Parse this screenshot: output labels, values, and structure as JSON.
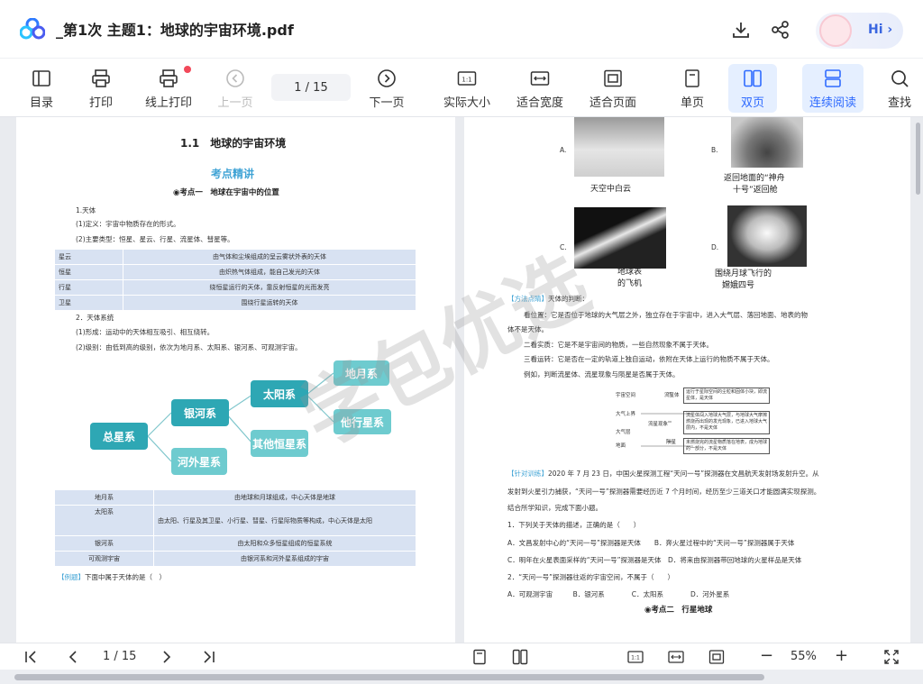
{
  "app": {
    "doc_title": "_第1次 主题1：地球的宇宙环境.pdf",
    "hi_label": "Hi",
    "hi_chevron": "›"
  },
  "icons": {
    "logo": "cloud-logo-icon",
    "download": "download-icon",
    "share": "share-icon"
  },
  "toolbar": {
    "toc": "目录",
    "print": "打印",
    "online_print": "线上打印",
    "prev": "上一页",
    "page_display": "1  / 15",
    "next": "下一页",
    "actual_size": "实际大小",
    "fit_width": "适合宽度",
    "fit_page": "适合页面",
    "single": "单页",
    "double": "双页",
    "continuous": "连续阅读",
    "search": "查找",
    "actual_size_glyph": "1:1"
  },
  "left_page": {
    "title": "1.1　地球的宇宙环境",
    "section": "考点精讲",
    "topic1": "◉考点一　地球在宇宙中的位置",
    "lines": [
      "1.天体",
      "(1)定义：宇宙中物质存在的形式。",
      "(2)主要类型：恒星、星云、行星、流星体、彗星等。"
    ],
    "table1": [
      [
        "星云",
        "由气体和尘埃组成的呈云雾状外表的天体"
      ],
      [
        "恒星",
        "由炽热气体组成，能自己发光的天体"
      ],
      [
        "行星",
        "绕恒星运行的天体，靠反射恒星的光而发亮"
      ],
      [
        "卫星",
        "围绕行星运转的天体"
      ]
    ],
    "lines2": [
      "2．天体系统",
      "(1)形成：运动中的天体相互吸引、相互绕转。",
      "(2)级别：由低到高的级别，依次为地月系、太阳系、银河系、可观测宇宙。"
    ],
    "diagram": {
      "total": "总星系",
      "milky": "银河系",
      "outer": "河外星系",
      "solar": "太阳系",
      "other_star": "其他恒星系",
      "earth_moon": "地月系",
      "other_planet": "他行星系"
    },
    "table2": [
      [
        "地月系",
        "由地球和月球组成，中心天体是地球"
      ],
      [
        "太阳系",
        "由太阳、行星及其卫星、小行星、彗星、行星际物质等构成，中心天体是太阳"
      ],
      [
        "银河系",
        "由太阳和众多恒星组成的恒星系统"
      ],
      [
        "可观测宇宙",
        "由银河系和河外星系组成的宇宙"
      ]
    ],
    "example_tag": "【例题】",
    "example_text": "下面中属于天体的是（　）"
  },
  "right_page": {
    "opt_a": "A.",
    "cap_a": "天空中白云",
    "opt_b": "B.",
    "cap_b1": "返回地面的“神舟",
    "cap_b2": "十号”返回舱",
    "opt_c": "C.",
    "cap_c1": "地球表",
    "cap_c2": "的飞机",
    "opt_d": "D.",
    "cap_d1": "围绕月球飞行的",
    "cap_d2": "嫦娥四号",
    "tip_tag": "【方法点睛】",
    "tip_lead": "天体的判断：",
    "tip1": "看位置：它是否位于地球的大气层之外，独立存在于宇宙中，进入大气层、落回地面、地表的物",
    "tip1b": "体不是天体。",
    "tip2": "二看实质：它是不是宇宙间的物质，一些自然现象不属于天体。",
    "tip3": "三看运转：它是否在一定的轨道上独自运动，依附在天体上运行的物质不属于天体。",
    "tip4": "例如，判断流星体、流星现象与陨星是否属于天体。",
    "mini": {
      "space": "宇宙空间",
      "atmo_top": "大气上界",
      "atmo": "大气层",
      "ground": "地面",
      "meteoroid": "流星体",
      "meteor": "流星现象",
      "meteorite": "陨星",
      "box1": "运行于星际空间的尘粒和固体小块，即流星体，是天体",
      "box2": "流星体闯入地球大气层，与地球大气摩擦燃烧而出现的发光现象，已进入地球大气层内，不是天体",
      "box3": "未燃烧完的流星物质落在地表，成为地球的一部分，不是天体"
    },
    "drill_tag": "【针对训练】",
    "drill1": "2020 年 7 月 23 日，中国火星探测工程“天问一号”探测器在文昌航天发射场发射升空。从",
    "drill2": "发射到火星引力捕获，“天问一号”探测器需要经历近 7 个月时间，经历至少三道关口才能圆满实现探测。",
    "drill3": "结合所学知识，完成下面小题。",
    "q1": "1．下列关于天体的描述，正确的是（　　）",
    "q1ab": "A．文昌发射中心的“天问一号”探测器是天体　　B．奔火星过程中的“天问一号”探测器属于天体",
    "q1cd": "C．明年在火星表面采样的“天问一号”探测器是天体　D．将来由探测器带回地球的火星样品是天体",
    "q2": "2．“天问一号”探测器往返的宇宙空间，不属于（　　）",
    "q2opts": "A．可观测宇宙　　　B．银河系　　　　C．太阳系　　　　D．河外星系",
    "topic2": "◉考点二　行星地球"
  },
  "bottombar": {
    "page_display": "1  / 15",
    "zoom": "55%",
    "minus": "−",
    "plus": "+",
    "actual_size_glyph": "1:1"
  },
  "watermark": {
    "text": "学包优选"
  }
}
